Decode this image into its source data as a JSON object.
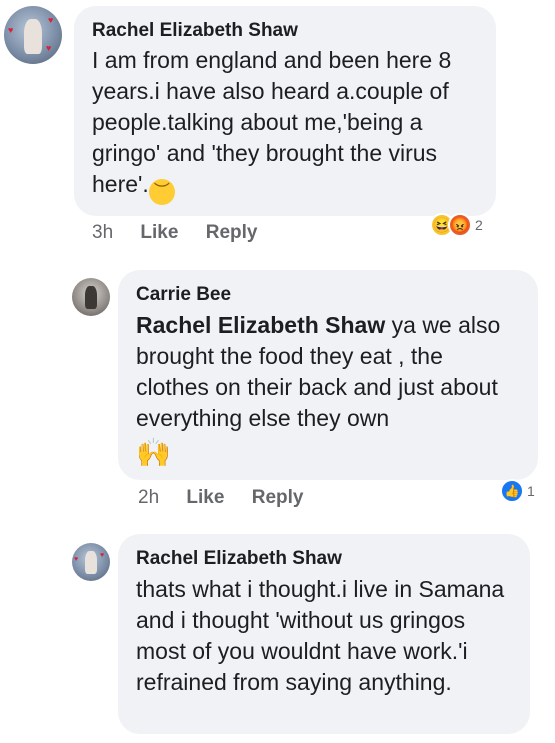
{
  "comments": [
    {
      "author": "Rachel Elizabeth Shaw",
      "text": "I am from england and been here 8 years.i have also heard a.couple of people.talking about me,'being a gringo' and 'they brought the virus here'.",
      "emoji": "disappointed-face",
      "time": "3h",
      "like_label": "Like",
      "reply_label": "Reply",
      "reactions": [
        "haha",
        "angry"
      ],
      "reaction_count": "2"
    },
    {
      "author": "Carrie Bee",
      "mention": "Rachel Elizabeth Shaw",
      "text": " ya we also brought the food they eat , the clothes on their back and just about everything else they own",
      "emoji": "raising-hands",
      "time": "2h",
      "like_label": "Like",
      "reply_label": "Reply",
      "reactions": [
        "like"
      ],
      "reaction_count": "1"
    },
    {
      "author": "Rachel Elizabeth Shaw",
      "text": "thats what i thought.i live in Samana and i thought 'without us gringos most of you wouldnt have work.'i refrained from saying anything."
    }
  ]
}
